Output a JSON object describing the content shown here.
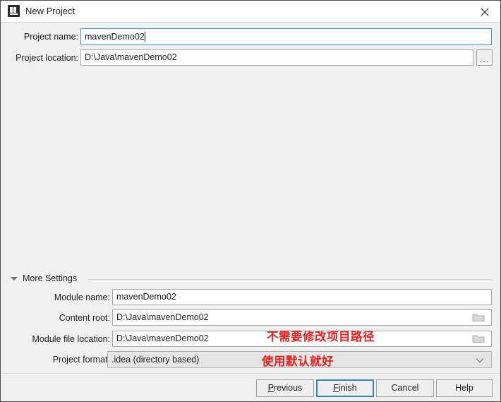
{
  "window": {
    "title": "New Project",
    "app_icon": "intellij-idea-icon",
    "close_icon": "close-icon"
  },
  "top_form": {
    "project_name": {
      "label": "Project name:",
      "value": "mavenDemo02",
      "focused": true
    },
    "project_location": {
      "label": "Project location:",
      "value": "D:\\Java\\mavenDemo02",
      "browse_label": "...",
      "browse_icon": "ellipsis-icon"
    }
  },
  "more_settings": {
    "label": "More Settings",
    "expanded": true,
    "toggle_icon": "chevron-down-icon",
    "fields": [
      {
        "name": "module-name",
        "label": "Module name:",
        "value": "mavenDemo02",
        "trailing_icon": null,
        "type": "text"
      },
      {
        "name": "content-root",
        "label": "Content root:",
        "value": "D:\\Java\\mavenDemo02",
        "trailing_icon": "folder-icon",
        "type": "text"
      },
      {
        "name": "module-file-location",
        "label": "Module file location:",
        "value": "D:\\Java\\mavenDemo02",
        "trailing_icon": "folder-icon",
        "type": "text"
      },
      {
        "name": "project-format",
        "label": "Project format:",
        "value": ".idea (directory based)",
        "trailing_icon": "chevron-down-icon",
        "type": "combobox"
      }
    ]
  },
  "annotations": [
    {
      "text": "不需要修改项目路径",
      "color": "#e8201f"
    },
    {
      "text": "使用默认就好",
      "color": "#e8201f"
    }
  ],
  "footer": {
    "buttons": [
      {
        "name": "previous",
        "label": "Previous",
        "mnemonic": "P",
        "default": false
      },
      {
        "name": "finish",
        "label": "Finish",
        "mnemonic": "F",
        "default": true
      },
      {
        "name": "cancel",
        "label": "Cancel",
        "mnemonic": "",
        "default": false
      },
      {
        "name": "help",
        "label": "Help",
        "mnemonic": "",
        "default": false
      }
    ]
  },
  "colors": {
    "dialog_background": "#f0f0f0",
    "titlebar_background": "#ffffff",
    "focus_blue": "#3c94c8",
    "default_button_border": "#2d89bf",
    "annotation_red": "#e8201f"
  }
}
